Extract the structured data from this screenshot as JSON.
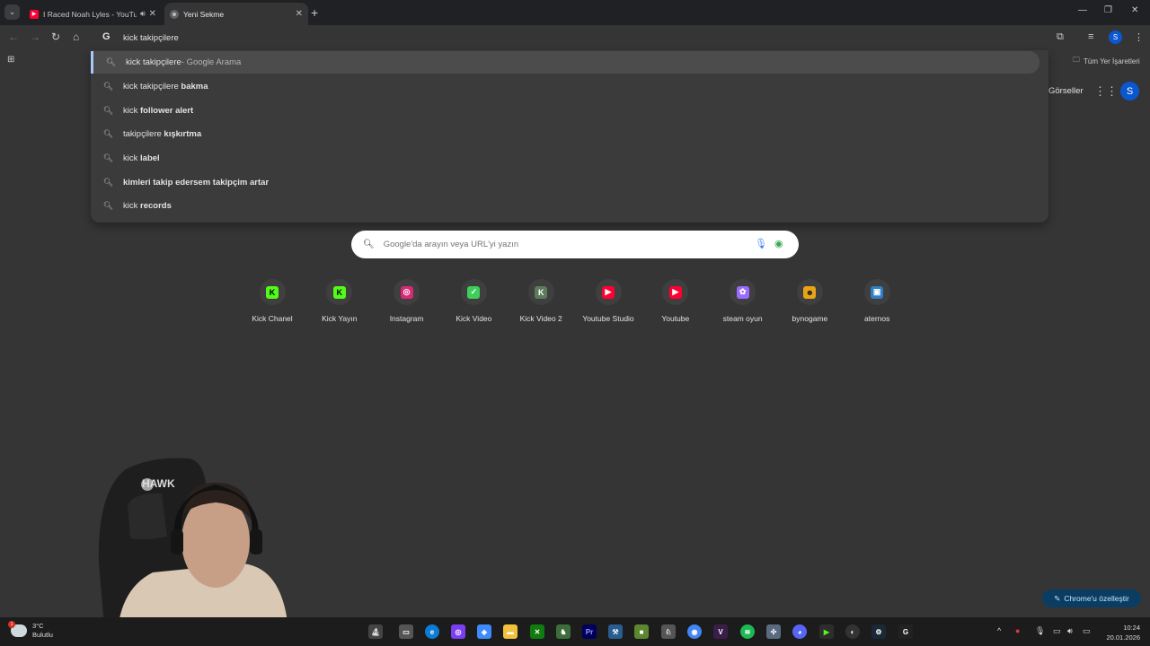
{
  "tabs": [
    {
      "title": "I Raced Noah Lyles - YouTube",
      "favicon": "youtube-icon",
      "audio": true,
      "active": false
    },
    {
      "title": "Yeni Sekme",
      "favicon": "chrome-icon",
      "audio": false,
      "active": true
    }
  ],
  "omnibox": {
    "engine_icon": "G",
    "value": "kick takipçilere"
  },
  "suggestions": [
    {
      "prefix": "kick takipçilere",
      "bold": "",
      "suffix": " - Google Arama",
      "selected": true
    },
    {
      "prefix": "kick takipçilere ",
      "bold": "bakma",
      "suffix": "",
      "selected": false
    },
    {
      "prefix": "kick ",
      "bold": "follower alert",
      "suffix": "",
      "selected": false
    },
    {
      "prefix": "takipçilere ",
      "bold": "kışkırtma",
      "suffix": "",
      "selected": false
    },
    {
      "prefix": "kick ",
      "bold": "label",
      "suffix": "",
      "selected": false
    },
    {
      "prefix": "",
      "bold": "kimleri takip edersem takipçim artar",
      "suffix": "",
      "selected": false
    },
    {
      "prefix": "kick ",
      "bold": "records",
      "suffix": "",
      "selected": false
    }
  ],
  "bookmarks": {
    "all_bookmarks": "Tüm Yer İşaretleri"
  },
  "google_header": {
    "images_link": "Görseller",
    "avatar_letter": "S"
  },
  "profile_letter": "S",
  "search": {
    "placeholder": "Google'da arayın veya URL'yi yazın"
  },
  "shortcuts": [
    {
      "label": "Kick Chanel",
      "icon": "kick-icon",
      "glyph": "K",
      "color": "#53fc18",
      "text_color": "#000"
    },
    {
      "label": "Kick Yayın",
      "icon": "kick-icon",
      "glyph": "K",
      "color": "#53fc18",
      "text_color": "#000"
    },
    {
      "label": "Instagram",
      "icon": "instagram-icon",
      "glyph": "◎",
      "color": "#d62976",
      "text_color": "#fff"
    },
    {
      "label": "Kick Video",
      "icon": "check-icon",
      "glyph": "✓",
      "color": "#3ecf5a",
      "text_color": "#fff"
    },
    {
      "label": "Kick Video 2",
      "icon": "letter-k-icon",
      "glyph": "K",
      "color": "#5d7a5d",
      "text_color": "#fff"
    },
    {
      "label": "Youtube Studio",
      "icon": "youtube-icon",
      "glyph": "▶",
      "color": "#ff0033",
      "text_color": "#fff"
    },
    {
      "label": "Youtube",
      "icon": "youtube-icon",
      "glyph": "▶",
      "color": "#ff0033",
      "text_color": "#fff"
    },
    {
      "label": "steam oyun",
      "icon": "purple-globe-icon",
      "glyph": "✿",
      "color": "#9b6bff",
      "text_color": "#fff"
    },
    {
      "label": "bynogame",
      "icon": "bynogame-icon",
      "glyph": "☻",
      "color": "#e8a317",
      "text_color": "#222"
    },
    {
      "label": "aternos",
      "icon": "aternos-icon",
      "glyph": "▣",
      "color": "#2f7ec7",
      "text_color": "#fff"
    }
  ],
  "customize_button": "Chrome'u özelleştir",
  "weather": {
    "temp": "3°C",
    "condition": "Bulutlu",
    "badge": "1"
  },
  "clock": {
    "time": "10:24",
    "date": "20.01.2026"
  },
  "colors": {
    "accent": "#a8c7fa",
    "page_bg": "#353535",
    "dropdown_bg": "#3b3b3b"
  }
}
